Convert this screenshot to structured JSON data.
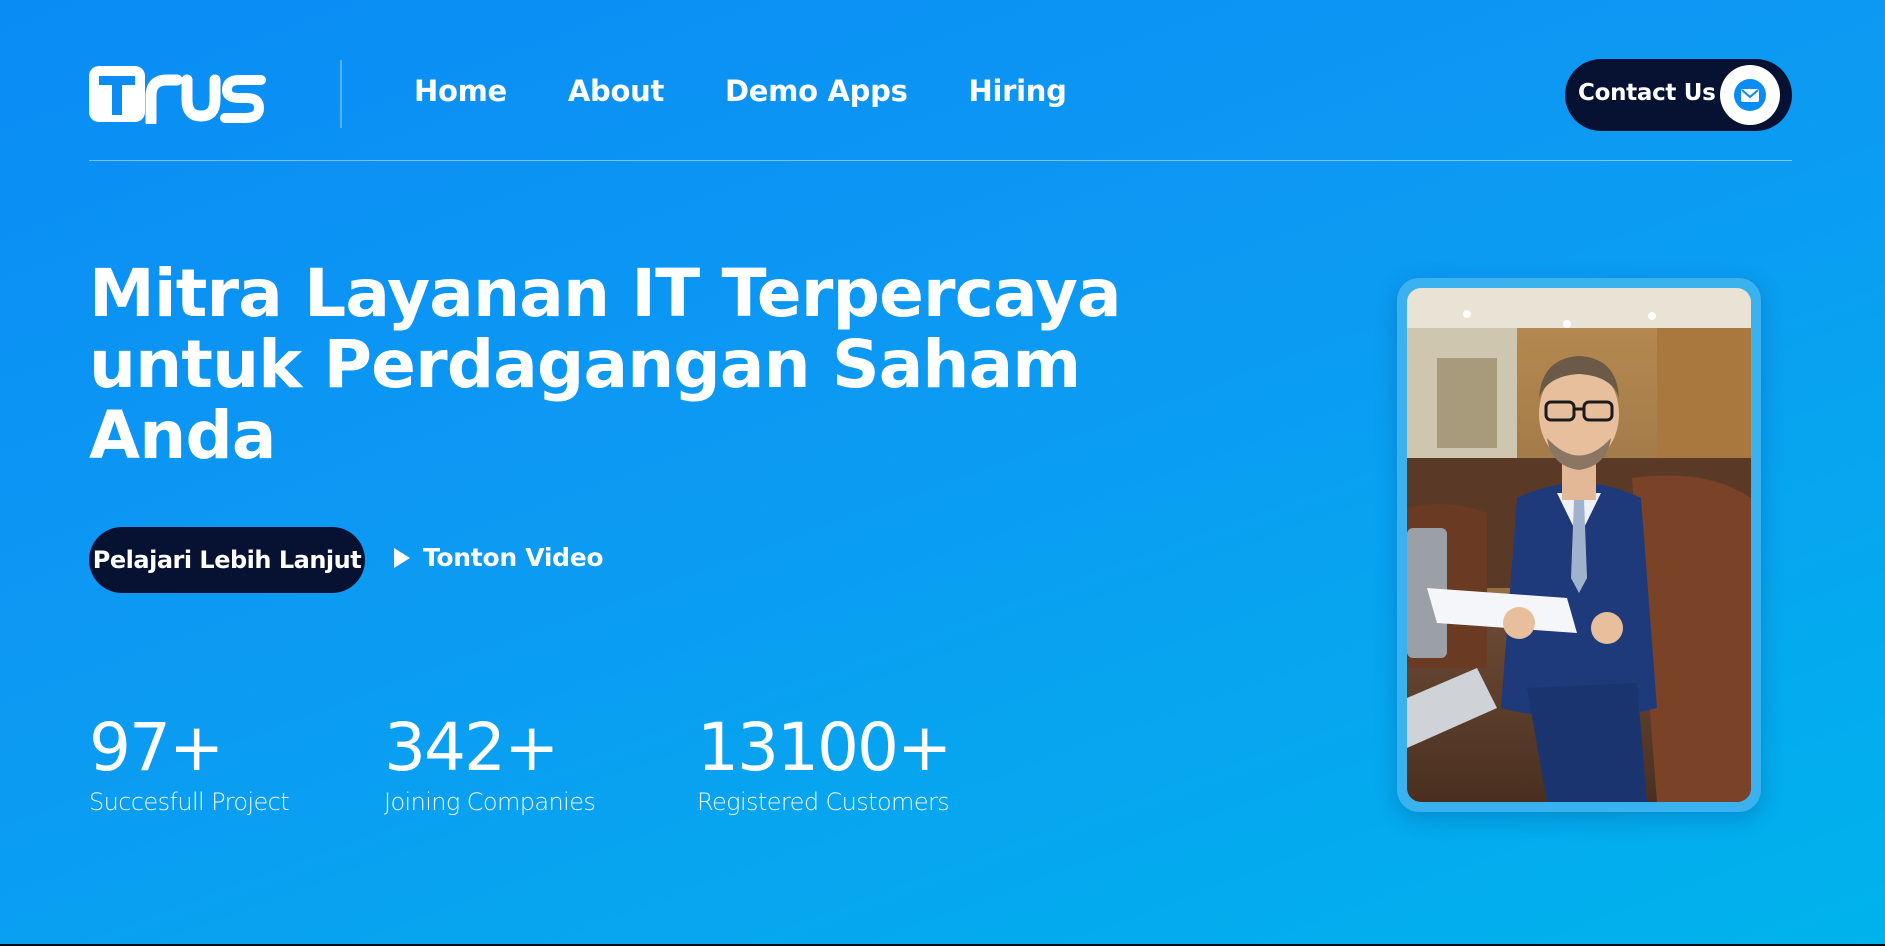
{
  "brand": {
    "logo_text": "Trus"
  },
  "nav": {
    "items": [
      {
        "label": "Home"
      },
      {
        "label": "About"
      },
      {
        "label": "Demo Apps"
      },
      {
        "label": "Hiring"
      }
    ],
    "contact_label": "Contact Us",
    "contact_icon": "mail-icon"
  },
  "hero": {
    "title_lines": [
      "Mitra Layanan IT Terpercaya",
      "untuk Perdagangan Saham",
      "Anda"
    ],
    "primary_button": "Pelajari Lebih Lanjut",
    "video_button": "Tonton Video",
    "video_icon": "play-icon"
  },
  "stats": [
    {
      "value": "97+",
      "label": "Succesfull Project"
    },
    {
      "value": "342+",
      "label": "Joining Companies"
    },
    {
      "value": "13100+",
      "label": "Registered Customers"
    }
  ],
  "photo": {
    "subject": "businessman-portrait"
  },
  "colors": {
    "background_start": "#0a8cf5",
    "background_end": "#00b3ec",
    "dark_button": "#071233",
    "frame": "#3ab2ef"
  }
}
